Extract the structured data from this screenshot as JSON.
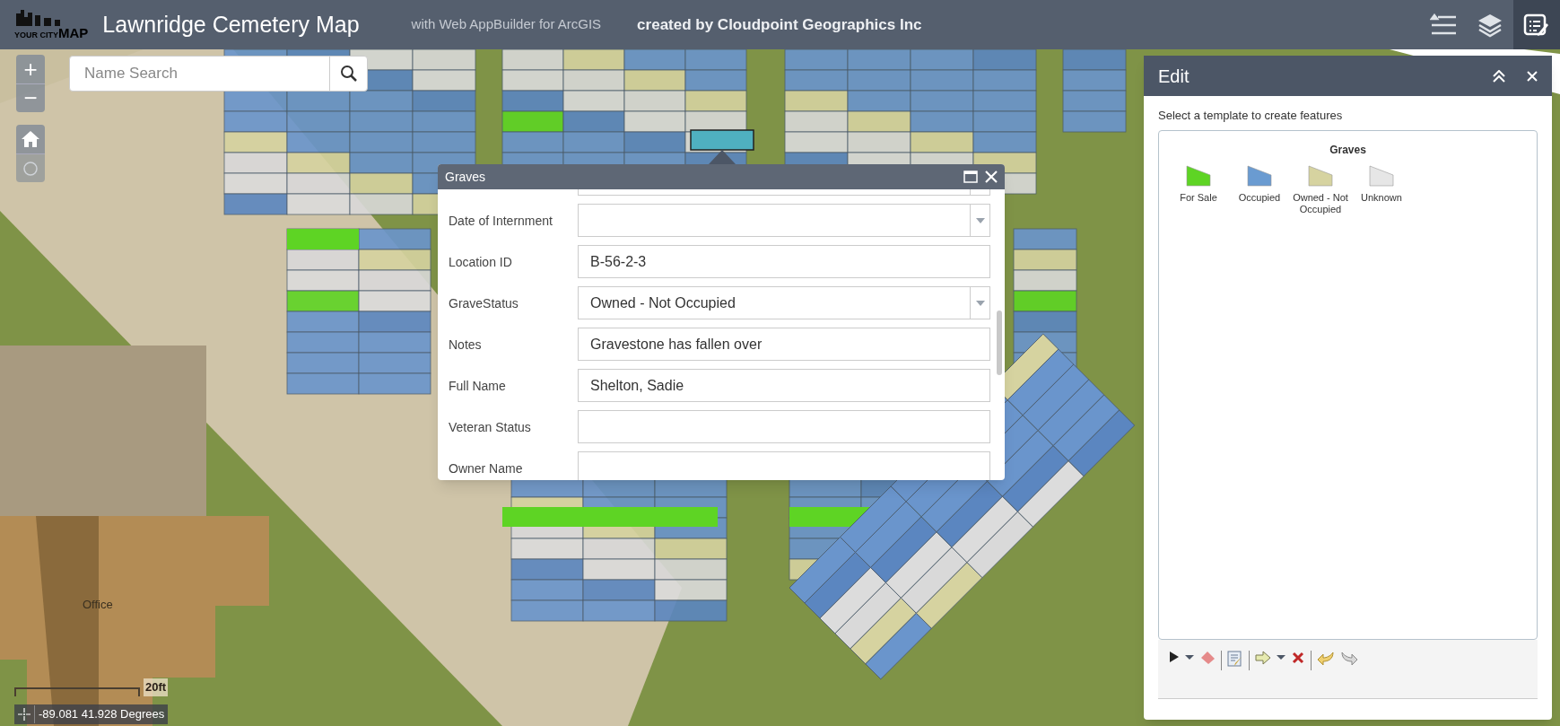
{
  "header": {
    "logo_small": "YOUR CITY",
    "logo_big": "MAP",
    "title": "Lawnridge Cemetery Map",
    "subtitle": "with Web AppBuilder for ArcGIS",
    "credit": "created by Cloudpoint Geographics Inc",
    "tools": [
      {
        "kind": "legend",
        "selected": false
      },
      {
        "kind": "layers",
        "selected": false
      },
      {
        "kind": "edit",
        "selected": true
      }
    ]
  },
  "map": {
    "zoom_in": "+",
    "zoom_out": "−",
    "search": {
      "placeholder": "Name Search"
    },
    "building_label": "Office",
    "scale": "20ft",
    "coordinates": "-89.081 41.928 Degrees"
  },
  "popup": {
    "title": "Graves",
    "fields": [
      {
        "kind": "select"
      },
      {
        "kind": "select",
        "label": "Date of Internment"
      },
      {
        "kind": "text",
        "label": "Location ID",
        "value": "B-56-2-3"
      },
      {
        "kind": "select",
        "label": "GraveStatus",
        "value": "Owned - Not Occupied"
      },
      {
        "kind": "text",
        "label": "Notes",
        "value": "Gravestone has fallen over"
      },
      {
        "kind": "text",
        "label": "Full Name",
        "value": "Shelton, Sadie"
      },
      {
        "kind": "text",
        "label": "Veteran Status"
      },
      {
        "kind": "text",
        "label": "Owner Name"
      }
    ]
  },
  "edit_panel": {
    "title": "Edit",
    "instruction": "Select a template to create features",
    "group": "Graves",
    "templates": [
      {
        "label": "For Sale",
        "color": "#5ed424"
      },
      {
        "label": "Occupied",
        "color": "#6a9bd1"
      },
      {
        "label": "Owned - Not Occupied",
        "color": "#d6d3a0"
      },
      {
        "label": "Unknown",
        "color": "#e6e6e6"
      }
    ]
  }
}
